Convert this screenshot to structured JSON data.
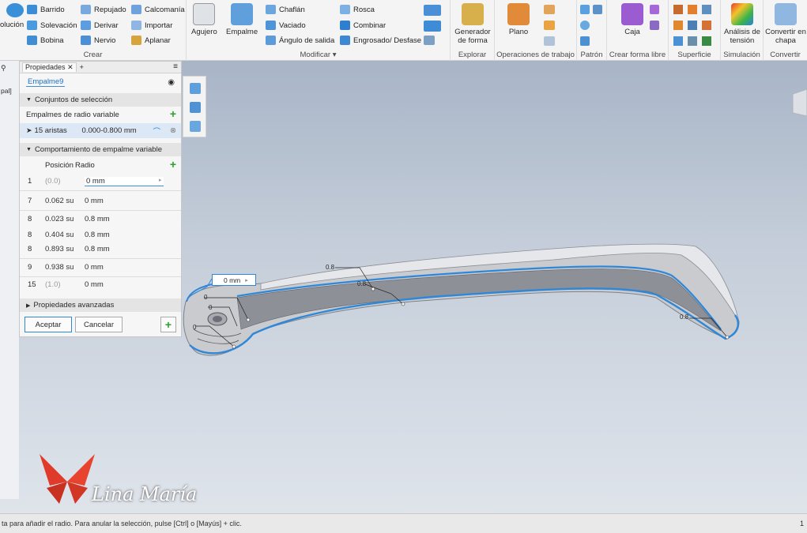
{
  "ribbon": {
    "crear": {
      "label": "Crear",
      "items": {
        "barrido": "Barrido",
        "solevacion": "Solevación",
        "bobina": "Bobina",
        "repujado": "Repujado",
        "derivar": "Derivar",
        "nervio": "Nervio",
        "calcomania": "Calcomanía",
        "importar": "Importar",
        "aplanar": "Aplanar",
        "revolucion": "olución"
      }
    },
    "modificar": {
      "label": "Modificar",
      "items": {
        "agujero": "Agujero",
        "empalme": "Empalme",
        "chaflan": "Chaflán",
        "vaciado": "Vaciado",
        "angulo": "Ángulo de salida",
        "rosca": "Rosca",
        "combinar": "Combinar",
        "engrosado": "Engrosado/ Desfase"
      }
    },
    "explorar": {
      "label": "Explorar",
      "generador": "Generador de forma"
    },
    "operaciones": {
      "label": "Operaciones de trabajo",
      "plano": "Plano"
    },
    "patron": {
      "label": "Patrón"
    },
    "forma_libre": {
      "label": "Crear forma libre",
      "caja": "Caja"
    },
    "superficie": {
      "label": "Superficie"
    },
    "simulacion": {
      "label": "Simulación",
      "analisis": "Análisis de tensión"
    },
    "convertir": {
      "label": "Convertir",
      "chapa": "Convertir en chapa"
    }
  },
  "panel": {
    "tab": "Propiedades",
    "feature_name": "Empalme9",
    "sec_sets": "Conjuntos de selección",
    "var_radius_label": "Empalmes de radio variable",
    "edges": "15 aristas",
    "range": "0.000-0.800 mm",
    "sec_behavior": "Comportamiento de empalme variable",
    "col_pos": "Posición",
    "col_rad": "Radio",
    "rows": [
      {
        "n": "1",
        "pos": "(0.0)",
        "rad": "0 mm"
      },
      {
        "n": "7",
        "pos": "0.062 su",
        "rad": "0 mm"
      },
      {
        "n": "8",
        "pos": "0.023 su",
        "rad": "0.8 mm"
      },
      {
        "n": "8",
        "pos": "0.404 su",
        "rad": "0.8 mm"
      },
      {
        "n": "8",
        "pos": "0.893 su",
        "rad": "0.8 mm"
      },
      {
        "n": "9",
        "pos": "0.938 su",
        "rad": "0 mm"
      },
      {
        "n": "15",
        "pos": "(1.0)",
        "rad": "0 mm"
      }
    ],
    "advanced": "Propiedades avanzadas",
    "accept": "Aceptar",
    "cancel": "Cancelar"
  },
  "left_browser": {
    "item": "pal]"
  },
  "viewport": {
    "callout_value": "0 mm",
    "labels": {
      "a": "0.8",
      "b": "0.8",
      "c": "0.8",
      "d": "0",
      "e": "0",
      "f": "0"
    }
  },
  "status": {
    "text": "ta para añadir el radio. Para anular la selección, pulse [Ctrl] o [Mayús] + clic.",
    "right": "1"
  },
  "watermark": {
    "text": "Lina María"
  },
  "colors": {
    "accent": "#2f87d8",
    "ribbon": "#f4f4f4",
    "viewport_top": "#a9b6c8",
    "viewport_bottom": "#e4e8ee",
    "green": "#2aa12a"
  }
}
